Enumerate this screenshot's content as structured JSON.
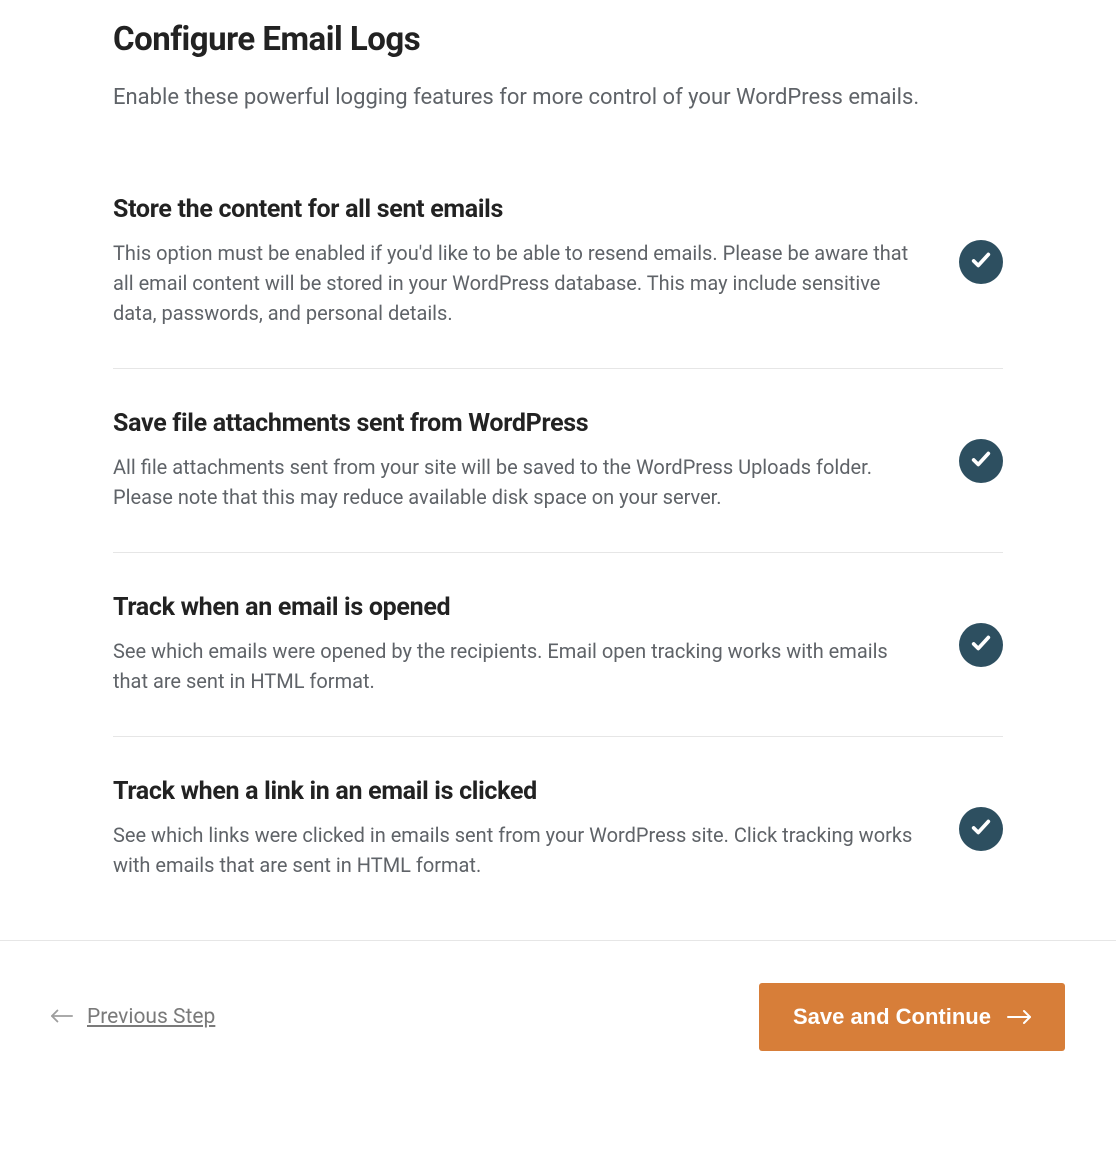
{
  "header": {
    "title": "Configure Email Logs",
    "subtitle": "Enable these powerful logging features for more control of your WordPress emails."
  },
  "options": [
    {
      "title": "Store the content for all sent emails",
      "description": "This option must be enabled if you'd like to be able to resend emails. Please be aware that all email content will be stored in your WordPress database. This may include sensitive data, passwords, and personal details.",
      "enabled": true
    },
    {
      "title": "Save file attachments sent from WordPress",
      "description": "All file attachments sent from your site will be saved to the WordPress Uploads folder. Please note that this may reduce available disk space on your server.",
      "enabled": true
    },
    {
      "title": "Track when an email is opened",
      "description": "See which emails were opened by the recipients. Email open tracking works with emails that are sent in HTML format.",
      "enabled": true
    },
    {
      "title": "Track when a link in an email is clicked",
      "description": "See which links were clicked in emails sent from your WordPress site. Click tracking works with emails that are sent in HTML format.",
      "enabled": true
    }
  ],
  "footer": {
    "prev_label": "Previous Step",
    "save_label": "Save and Continue"
  },
  "colors": {
    "toggle_bg": "#2d4f60",
    "button_bg": "#d77e39"
  }
}
